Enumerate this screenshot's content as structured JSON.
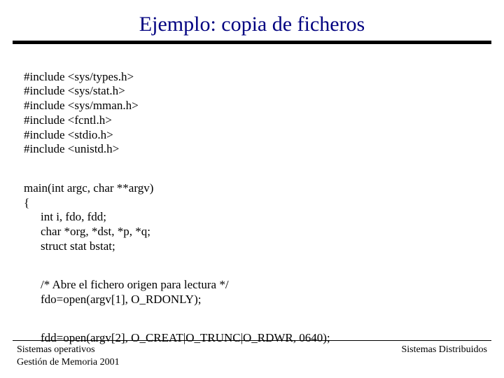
{
  "title": "Ejemplo: copia de ficheros",
  "includes": [
    "#include <sys/types.h>",
    "#include <sys/stat.h>",
    "#include <sys/mman.h>",
    "#include <fcntl.h>",
    "#include <stdio.h>",
    "#include <unistd.h>"
  ],
  "main_sig": "main(int argc, char **argv)",
  "brace_open": "{",
  "decls": [
    "int i, fdo, fdd;",
    "char *org, *dst, *p, *q;",
    "struct stat bstat;"
  ],
  "comment_open": "/* Abre el fichero origen para lectura */",
  "open_origin": "fdo=open(argv[1], O_RDONLY);",
  "open_dest": "fdd=open(argv[2], O_CREAT|O_TRUNC|O_RDWR, 0640);",
  "footer": {
    "left1": "Sistemas operativos",
    "left2": "Gestión de Memoria 2001",
    "right": "Sistemas Distribuidos"
  }
}
